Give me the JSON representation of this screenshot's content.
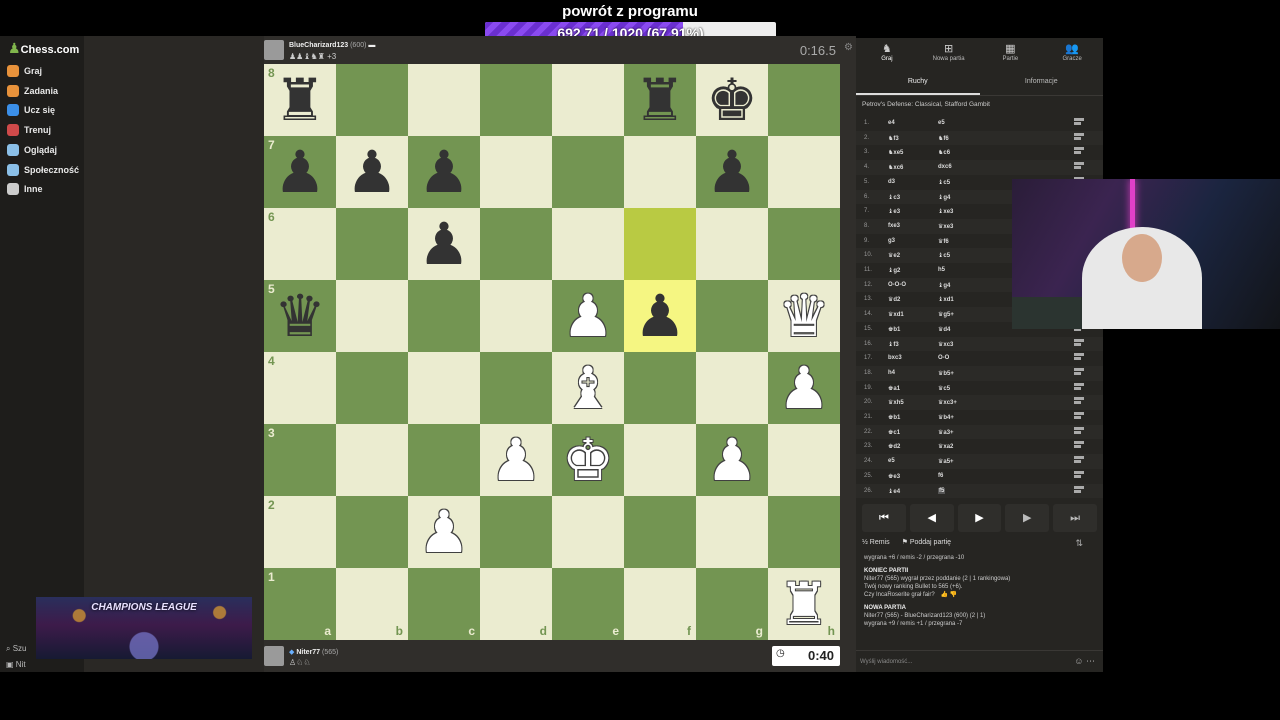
{
  "overlay": {
    "title": "powrót z programu",
    "progress_text": "692.71 / 1020 (67.91%)",
    "progress_fraction": 0.6791
  },
  "nav": {
    "logo": "Chess.com",
    "items": [
      {
        "label": "Graj",
        "color": "#e8923b"
      },
      {
        "label": "Zadania",
        "color": "#e8923b"
      },
      {
        "label": "Ucz się",
        "color": "#3b8fe8"
      },
      {
        "label": "Trenuj",
        "color": "#d04a4a"
      },
      {
        "label": "Oglądaj",
        "color": "#8bc0e8"
      },
      {
        "label": "Społeczność",
        "color": "#8bc0e8"
      },
      {
        "label": "Inne",
        "color": "#cccccc"
      }
    ],
    "bottom_search": "Szu",
    "bottom_user": "Nit"
  },
  "banner": {
    "text": "CHAMPIONS LEAGUE"
  },
  "top_player": {
    "name": "BlueCharizard123",
    "rating": "(600)",
    "captured": "♟♟♝♞♜ +3",
    "clock": "0:16.5"
  },
  "bottom_player": {
    "name": "Niter77",
    "rating": "(565)",
    "captured": "♙♘♘",
    "clock": "0:40"
  },
  "board": {
    "files": [
      "a",
      "b",
      "c",
      "d",
      "e",
      "f",
      "g",
      "h"
    ],
    "ranks": [
      "8",
      "7",
      "6",
      "5",
      "4",
      "3",
      "2",
      "1"
    ],
    "highlights": [
      "f6",
      "f5"
    ],
    "pieces": [
      {
        "sq": "a8",
        "p": "♜",
        "c": "b"
      },
      {
        "sq": "f8",
        "p": "♜",
        "c": "b"
      },
      {
        "sq": "g8",
        "p": "♚",
        "c": "b"
      },
      {
        "sq": "a7",
        "p": "♟",
        "c": "b"
      },
      {
        "sq": "b7",
        "p": "♟",
        "c": "b"
      },
      {
        "sq": "c7",
        "p": "♟",
        "c": "b"
      },
      {
        "sq": "g7",
        "p": "♟",
        "c": "b"
      },
      {
        "sq": "c6",
        "p": "♟",
        "c": "b"
      },
      {
        "sq": "a5",
        "p": "♛",
        "c": "b"
      },
      {
        "sq": "e5",
        "p": "♟",
        "c": "w"
      },
      {
        "sq": "f5",
        "p": "♟",
        "c": "b"
      },
      {
        "sq": "h5",
        "p": "♛",
        "c": "w"
      },
      {
        "sq": "e4",
        "p": "♝",
        "c": "w"
      },
      {
        "sq": "h4",
        "p": "♟",
        "c": "w"
      },
      {
        "sq": "d3",
        "p": "♟",
        "c": "w"
      },
      {
        "sq": "e3",
        "p": "♚",
        "c": "w"
      },
      {
        "sq": "g3",
        "p": "♟",
        "c": "w"
      },
      {
        "sq": "c2",
        "p": "♟",
        "c": "w"
      },
      {
        "sq": "h1",
        "p": "♜",
        "c": "w"
      }
    ]
  },
  "panel": {
    "tabs": [
      {
        "label": "Graj",
        "icon": "♞"
      },
      {
        "label": "Nowa partia",
        "icon": "⊞"
      },
      {
        "label": "Partie",
        "icon": "▦"
      },
      {
        "label": "Gracze",
        "icon": "👥"
      }
    ],
    "subtabs": [
      "Ruchy",
      "Informacje"
    ],
    "opening": "Petrov's Defense: Classical, Stafford Gambit",
    "moves": [
      [
        "1.",
        "e4",
        "e5"
      ],
      [
        "2.",
        "♞f3",
        "♞f6"
      ],
      [
        "3.",
        "♞xe5",
        "♞c6"
      ],
      [
        "4.",
        "♞xc6",
        "dxc6"
      ],
      [
        "5.",
        "d3",
        "♝c5"
      ],
      [
        "6.",
        "♝c3",
        "♝g4"
      ],
      [
        "7.",
        "♝e3",
        "♝xe3"
      ],
      [
        "8.",
        "fxe3",
        "♛xe3"
      ],
      [
        "9.",
        "g3",
        "♛f6"
      ],
      [
        "10.",
        "♛e2",
        "♝c5"
      ],
      [
        "11.",
        "♝g2",
        "h5"
      ],
      [
        "12.",
        "O-O-O",
        "♝g4"
      ],
      [
        "13.",
        "♛d2",
        "♝xd1"
      ],
      [
        "14.",
        "♛xd1",
        "♛g5+"
      ],
      [
        "15.",
        "♚b1",
        "♛d4"
      ],
      [
        "16.",
        "♝f3",
        "♛xc3"
      ],
      [
        "17.",
        "bxc3",
        "O-O"
      ],
      [
        "18.",
        "h4",
        "♛b5+"
      ],
      [
        "19.",
        "♚a1",
        "♛c5"
      ],
      [
        "20.",
        "♛xh5",
        "♛xc3+"
      ],
      [
        "21.",
        "♚b1",
        "♛b4+"
      ],
      [
        "22.",
        "♚c1",
        "♛a3+"
      ],
      [
        "23.",
        "♚d2",
        "♛xa2"
      ],
      [
        "24.",
        "e5",
        "♛a5+"
      ],
      [
        "25.",
        "♚e3",
        "f6"
      ],
      [
        "26.",
        "♝e4",
        "f5"
      ]
    ],
    "controls": [
      "⏮",
      "◀",
      "▶",
      "▶",
      "⏭"
    ],
    "actions": {
      "draw": "½ Remis",
      "resign": "Poddaj partię",
      "flip": "⇅"
    },
    "chat": [
      {
        "t": "wygrana +6 / remis -2 / przegrana -10",
        "h": false
      },
      {
        "t": "KONIEC PARTII",
        "h": true
      },
      {
        "t": "Niter77 (565) wygrał przez poddanie (2 | 1 rankingowa)",
        "h": false
      },
      {
        "t": "Twój nowy ranking Bullet to 565 (+6).",
        "h": false
      },
      {
        "t": "Czy IncaRoserite grał fair?",
        "h": false
      },
      {
        "t": "NOWA PARTIA",
        "h": true
      },
      {
        "t": "Niter77 (565) - BlueCharizard123 (600) (2 | 1)",
        "h": false
      },
      {
        "t": "wygrana +9 / remis +1 / przegrana -7",
        "h": false
      }
    ],
    "chat_placeholder": "Wyślij wiadomość..."
  }
}
